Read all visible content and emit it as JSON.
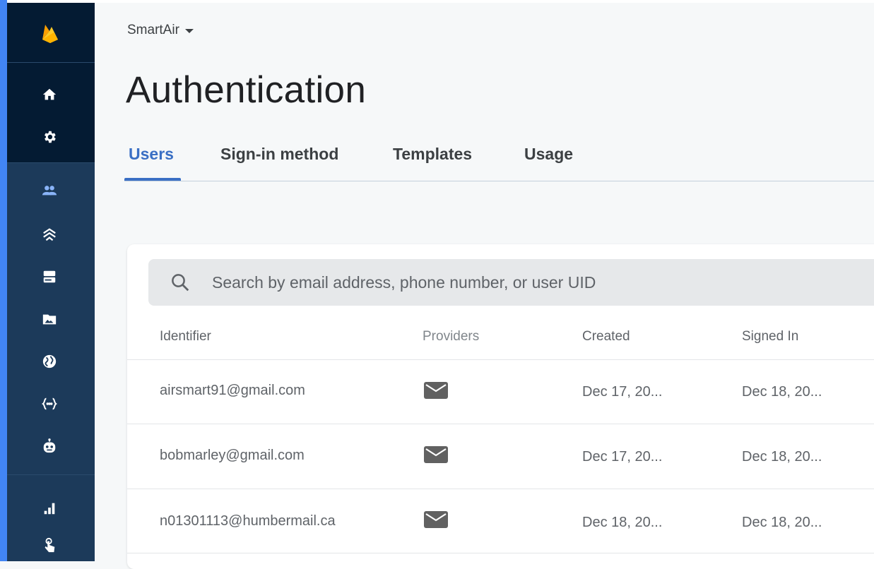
{
  "project": {
    "name": "SmartAir"
  },
  "page": {
    "title": "Authentication"
  },
  "tabs": [
    {
      "label": "Users",
      "active": true
    },
    {
      "label": "Sign-in method",
      "active": false
    },
    {
      "label": "Templates",
      "active": false
    },
    {
      "label": "Usage",
      "active": false
    }
  ],
  "search": {
    "placeholder": "Search by email address, phone number, or user UID"
  },
  "table": {
    "columns": [
      "Identifier",
      "Providers",
      "Created",
      "Signed In"
    ],
    "rows": [
      {
        "identifier": "airsmart91@gmail.com",
        "provider": "email-icon",
        "created": "Dec 17, 20...",
        "signed_in": "Dec 18, 20..."
      },
      {
        "identifier": "bobmarley@gmail.com",
        "provider": "email-icon",
        "created": "Dec 17, 20...",
        "signed_in": "Dec 18, 20..."
      },
      {
        "identifier": "n01301113@humbermail.ca",
        "provider": "email-icon",
        "created": "Dec 18, 20...",
        "signed_in": "Dec 18, 20..."
      }
    ]
  },
  "sidebar": {
    "icons": [
      "firebase-logo",
      "home-icon",
      "gear-icon",
      "users-icon",
      "realtime-database-icon",
      "firestore-icon",
      "storage-icon",
      "hosting-icon",
      "functions-icon",
      "ml-kit-icon",
      "analytics-icon",
      "engage-icon"
    ]
  },
  "colors": {
    "accent": "#3a6fc4",
    "sidebar": "#1c3a5a",
    "sidebar_top": "#041b33",
    "firebase_yellow": "#ffca28"
  }
}
